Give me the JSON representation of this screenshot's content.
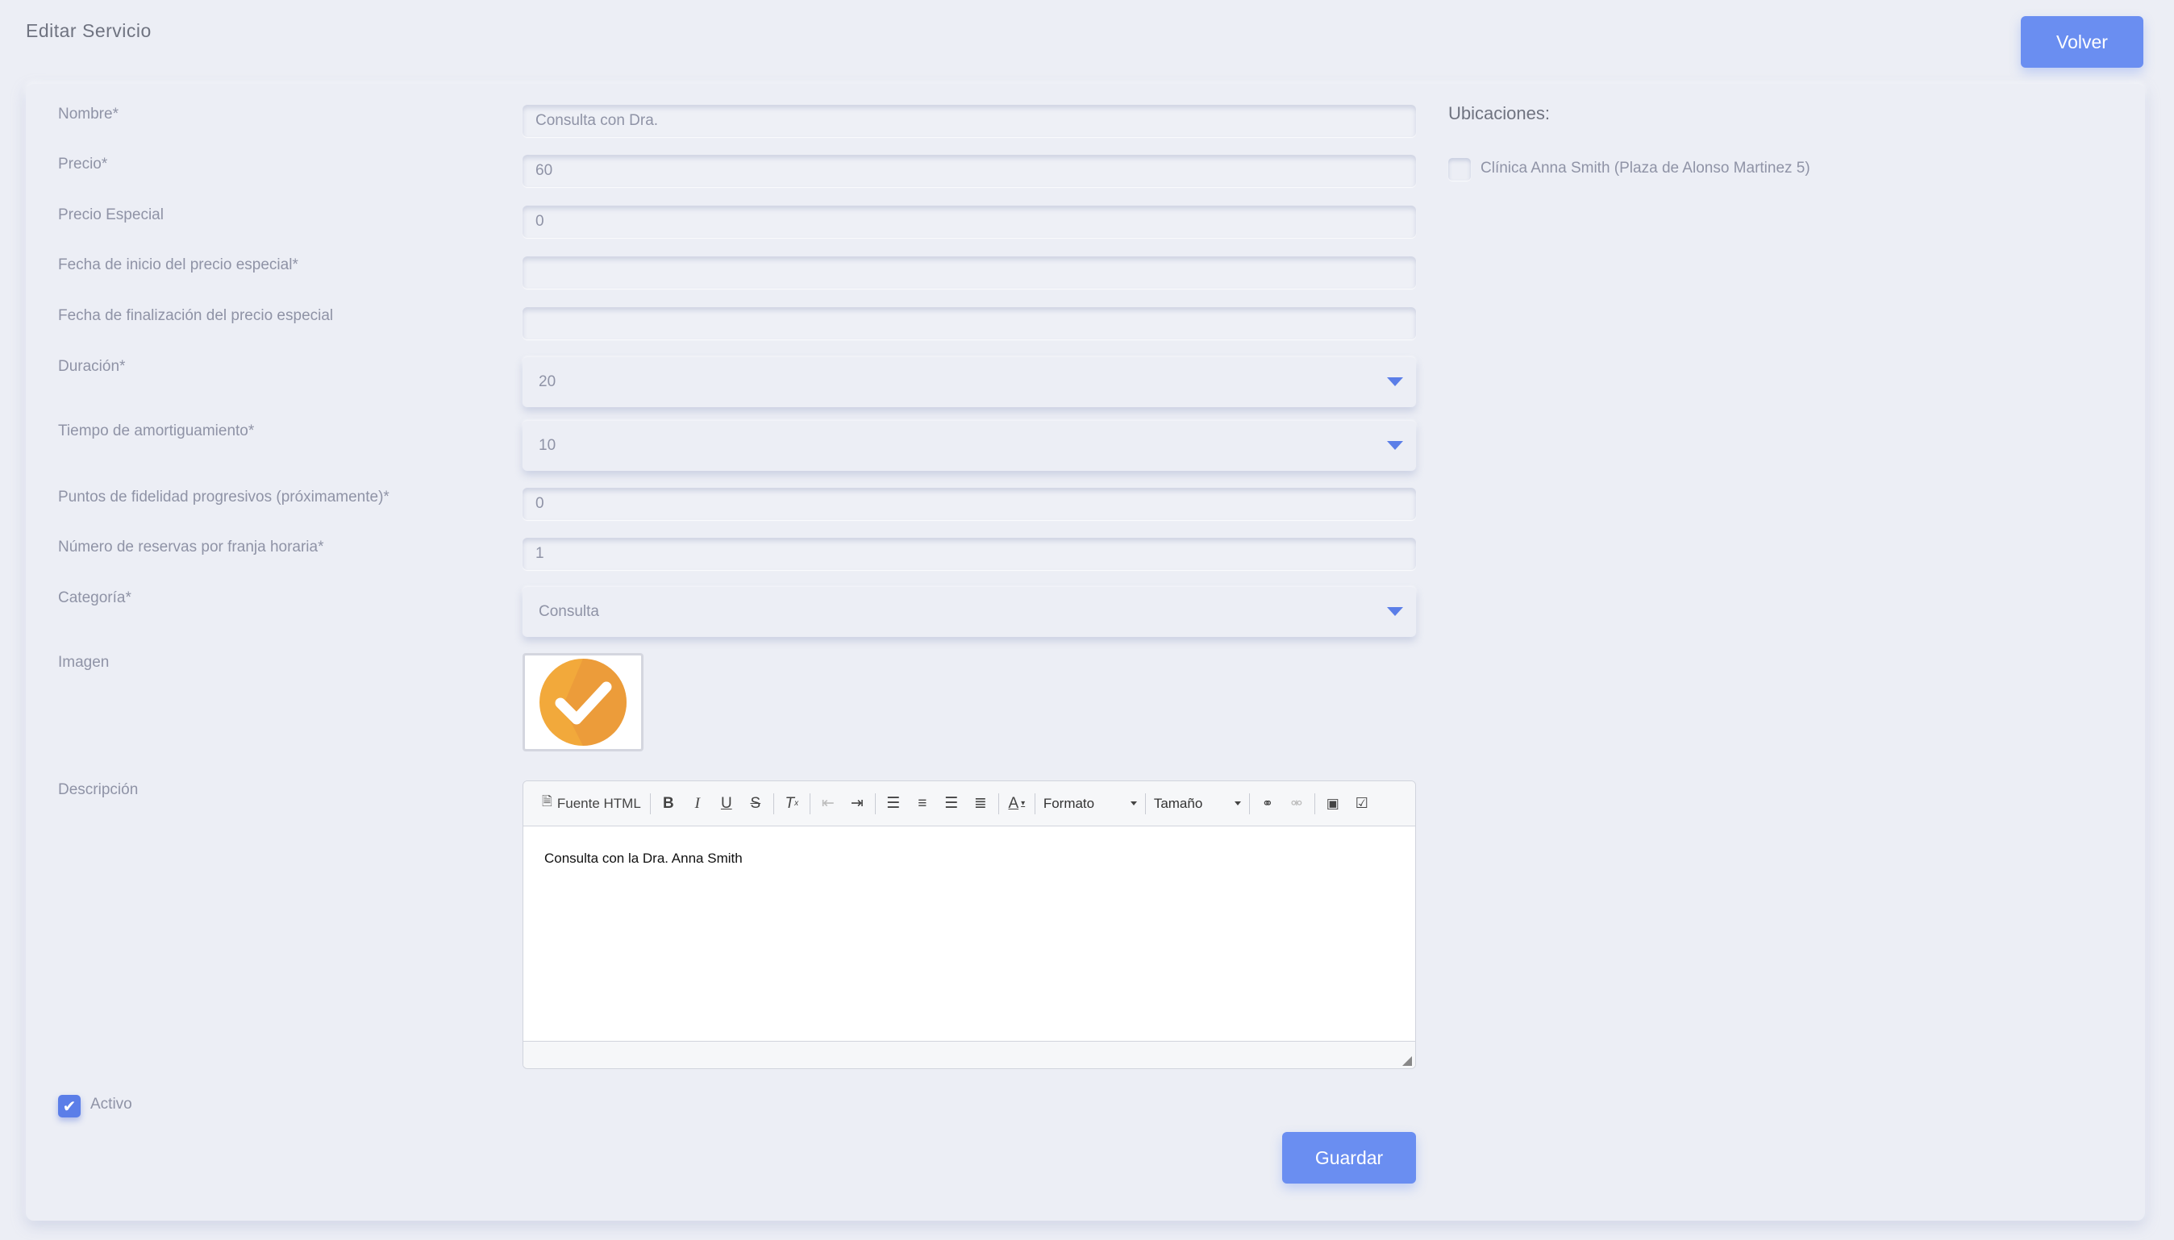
{
  "header": {
    "title": "Editar Servicio",
    "back_button": "Volver"
  },
  "form": {
    "nombre": {
      "label": "Nombre*",
      "value": "Consulta con Dra."
    },
    "precio": {
      "label": "Precio*",
      "value": "60"
    },
    "precio_especial": {
      "label": "Precio Especial",
      "value": "0"
    },
    "fecha_inicio": {
      "label": "Fecha de inicio del precio especial*",
      "value": ""
    },
    "fecha_fin": {
      "label": "Fecha de finalización del precio especial",
      "value": ""
    },
    "duracion": {
      "label": "Duración*",
      "value": "20"
    },
    "tiempo_amortiguamiento": {
      "label": "Tiempo de amortiguamiento*",
      "value": "10"
    },
    "puntos_fidelidad": {
      "label": "Puntos de fidelidad progresivos (próximamente)*",
      "value": "0"
    },
    "reservas_franja": {
      "label": "Número de reservas por franja horaria*",
      "value": "1"
    },
    "categoria": {
      "label": "Categoría*",
      "value": "Consulta"
    },
    "imagen": {
      "label": "Imagen",
      "icon": "orange-checkmark-icon"
    },
    "descripcion": {
      "label": "Descripción",
      "content": "Consulta con la Dra. Anna Smith",
      "toolbar": {
        "source_label": "Fuente HTML",
        "format_label": "Formato",
        "size_label": "Tamaño"
      }
    },
    "activo": {
      "label": "Activo",
      "checked": true
    },
    "save_button": "Guardar"
  },
  "locations": {
    "title": "Ubicaciones:",
    "items": [
      {
        "label": "Clínica Anna Smith (Plaza de Alonso Martinez 5)",
        "checked": false
      }
    ]
  },
  "colors": {
    "background": "#eceef5",
    "accent": "#6a8ef1",
    "label": "#8f93a6",
    "check_orange": "#f0a23a"
  }
}
